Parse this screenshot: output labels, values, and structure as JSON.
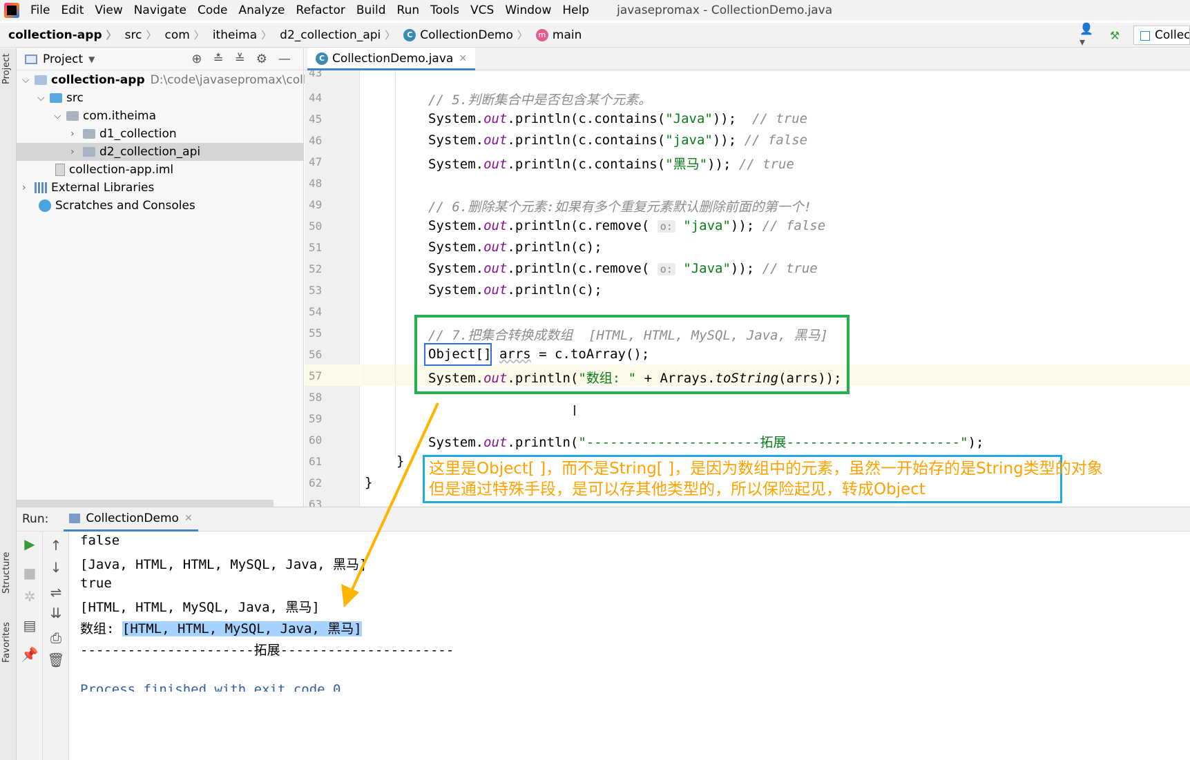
{
  "menubar": {
    "items": [
      "File",
      "Edit",
      "View",
      "Navigate",
      "Code",
      "Analyze",
      "Refactor",
      "Build",
      "Run",
      "Tools",
      "VCS",
      "Window",
      "Help"
    ],
    "window_title": "javasepromax - CollectionDemo.java"
  },
  "navbar": {
    "crumbs": [
      "collection-app",
      "src",
      "com",
      "itheima",
      "d2_collection_api",
      "CollectionDemo",
      "main"
    ],
    "run_config": "Collect"
  },
  "project_panel": {
    "title": "Project",
    "tree": [
      {
        "label": "collection-app",
        "path": "D:\\code\\javasepromax\\collectio"
      },
      {
        "label": "src"
      },
      {
        "label": "com.itheima"
      },
      {
        "label": "d1_collection"
      },
      {
        "label": "d2_collection_api"
      },
      {
        "label": "collection-app.iml"
      },
      {
        "label": "External Libraries"
      },
      {
        "label": "Scratches and Consoles"
      }
    ]
  },
  "left_stripe": {
    "project": "Project",
    "structure": "Structure",
    "favorites": "Favorites"
  },
  "editor": {
    "tab": "CollectionDemo.java",
    "line_numbers": [
      "43",
      "44",
      "45",
      "46",
      "47",
      "48",
      "49",
      "50",
      "51",
      "52",
      "53",
      "54",
      "55",
      "56",
      "57",
      "58",
      "59",
      "60",
      "61",
      "62",
      "63"
    ],
    "comments": {
      "c5": "// 5.判断集合中是否包含某个元素。",
      "r45": "// true",
      "r46": "// false",
      "r47": "// true",
      "c6": "// 6.删除某个元素:如果有多个重复元素默认删除前面的第一个!",
      "r50": "// false",
      "r52": "// true",
      "c7": "// 7.把集合转换成数组  [HTML, HTML, MySQL, Java, 黑马]"
    },
    "strings": {
      "java_cap": "\"Java\"",
      "java_low": "\"java\"",
      "heima": "\"黑马\"",
      "shuzu": "\"数组: \"",
      "tuozhan": "\"----------------------拓展----------------------\""
    },
    "hint": "o:"
  },
  "annotation": {
    "line1": "这里是Object[ ]，而不是String[ ]，是因为数组中的元素，虽然一开始存的是String类型的对象",
    "line2": "但是通过特殊手段，是可以存其他类型的，所以保险起见，转成Object"
  },
  "run_panel": {
    "label": "Run:",
    "tab": "CollectionDemo",
    "output": [
      "false",
      "[Java, HTML, HTML, MySQL, Java, 黑马]",
      "true",
      "[HTML, HTML, MySQL, Java, 黑马]"
    ],
    "array_prefix": "数组: ",
    "array_value": "[HTML, HTML, MySQL, Java, 黑马]",
    "separator": "----------------------拓展----------------------",
    "process": "Process finished with exit code 0"
  },
  "colors": {
    "green_box": "#22b14c",
    "blue_box": "#1eaae6",
    "arrow": "#ffb400",
    "note_text": "#ffa200"
  }
}
